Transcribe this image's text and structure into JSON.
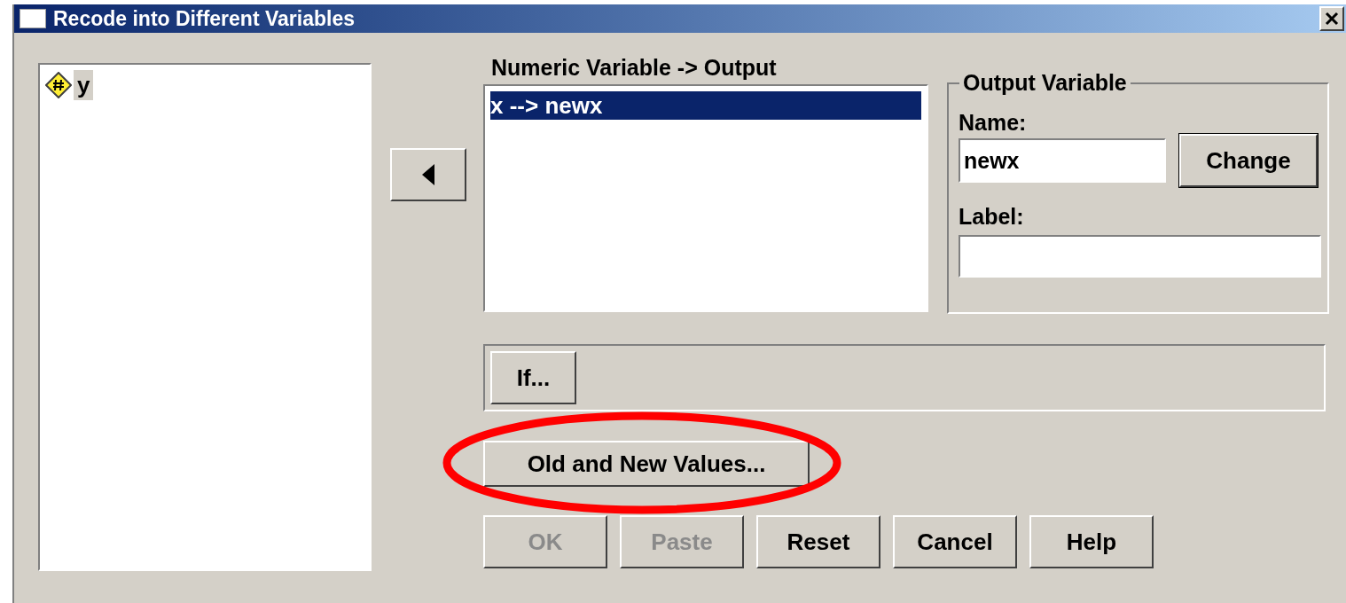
{
  "window": {
    "title": "Recode into Different Variables"
  },
  "source_list": {
    "items": [
      {
        "name": "y",
        "kind": "numeric",
        "selected": true
      }
    ]
  },
  "mapping": {
    "label": "Numeric Variable -> Output",
    "items": [
      {
        "text": "x --> newx",
        "selected": true
      }
    ]
  },
  "output_variable": {
    "title": "Output Variable",
    "name_label": "Name:",
    "name_value": "newx",
    "change_button": "Change",
    "label_label": "Label:"
  },
  "if_button": "If...",
  "old_new_button": {
    "label": "Old and New Values...",
    "circled": true
  },
  "buttons": [
    {
      "label": "OK",
      "disabled": true
    },
    {
      "label": "Paste",
      "disabled": true
    },
    {
      "label": "Reset",
      "disabled": false
    },
    {
      "label": "Cancel",
      "disabled": false
    },
    {
      "label": "Help",
      "disabled": false
    }
  ]
}
